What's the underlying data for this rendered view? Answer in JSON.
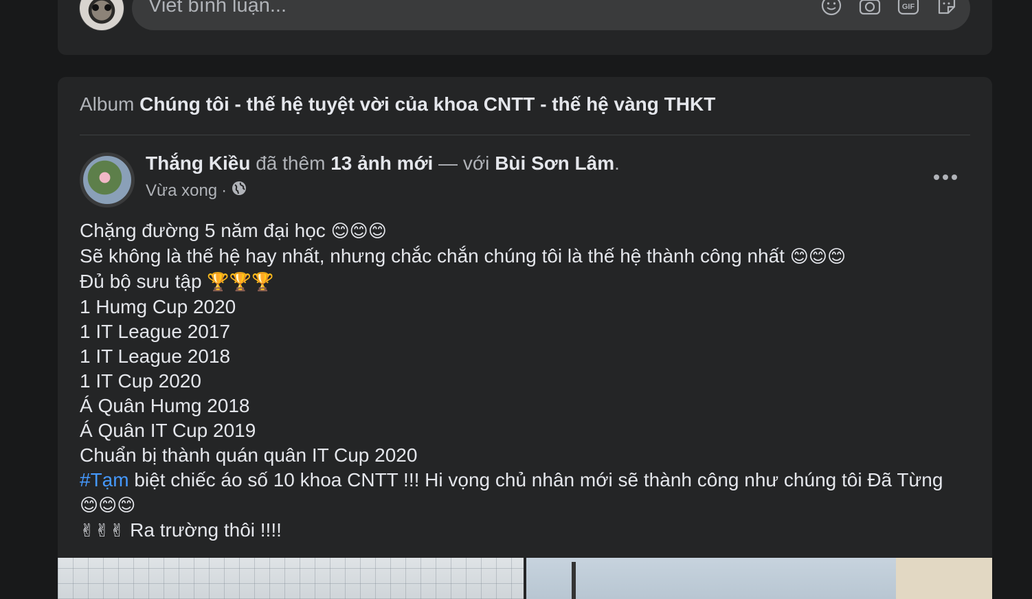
{
  "comment_box": {
    "placeholder": "Viết bình luận...",
    "icons": [
      "emoji-icon",
      "camera-icon",
      "gif-icon",
      "sticker-icon"
    ],
    "gif_label": "GIF"
  },
  "album": {
    "prefix": "Album",
    "name": "Chúng tôi - thế hệ tuyệt vời của khoa CNTT - thế hệ vàng THKT"
  },
  "post": {
    "author": "Thắng Kiều",
    "action": " đã thêm ",
    "count_text": "13 ảnh mới",
    "with_text": " — với ",
    "tagged": "Bùi Sơn Lâm",
    "end": ".",
    "time": "Vừa xong",
    "separator": "·",
    "privacy_icon": "globe-icon",
    "lines": {
      "l1": "Chặng đường 5 năm đại học ",
      "l1_emoji": "😊😊😊",
      "l2": "Sẽ không là thế hệ hay nhất, nhưng chắc chắn chúng tôi là thế hệ thành công nhất ",
      "l2_emoji": "😊😊😊",
      "l3": "Đủ bộ sưu tập ",
      "l3_emoji": "🏆🏆🏆",
      "l4": "1 Humg Cup 2020",
      "l5": "1 IT League 2017",
      "l6": "1 IT League 2018",
      "l7": "1 IT Cup 2020",
      "l8": "Á Quân Humg 2018",
      "l9": "Á Quân IT Cup 2019",
      "l10": "Chuẩn bị thành quán quân IT Cup 2020",
      "hashtag": "#Tạm",
      "l11": " biệt chiếc áo số 10 khoa CNTT !!! Hi vọng chủ nhân mới sẽ thành công như chúng tôi Đã Từng",
      "l12_emoji": "😊😊😊",
      "l13_emoji": "✌✌✌",
      "l13": " Ra trường thôi !!!!"
    }
  },
  "colors": {
    "background": "#18191a",
    "card": "#242526",
    "input": "#3a3b3c",
    "text_primary": "#e4e6eb",
    "text_secondary": "#b0b3b8",
    "hashtag": "#4599ff"
  }
}
